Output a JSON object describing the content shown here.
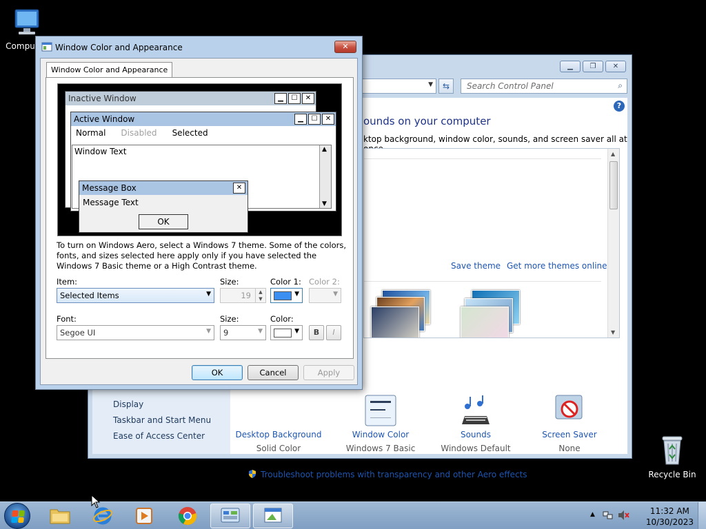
{
  "desktop": {
    "computer_label": "Computer",
    "recycle_bin_label": "Recycle Bin"
  },
  "personalization": {
    "search_placeholder": "Search Control Panel",
    "heading": "ounds on your computer",
    "description": "ktop background, window color, sounds, and screen saver all at once.",
    "save_theme": "Save theme",
    "get_more_themes": "Get more themes online",
    "left_links": [
      "Display",
      "Taskbar and Start Menu",
      "Ease of Access Center"
    ],
    "bottom_items": [
      {
        "label": "Desktop Background",
        "sub": "Solid Color",
        "icon": "desktop-background-icon"
      },
      {
        "label": "Window Color",
        "sub": "Windows 7 Basic",
        "icon": "window-color-icon"
      },
      {
        "label": "Sounds",
        "sub": "Windows Default",
        "icon": "sounds-icon"
      },
      {
        "label": "Screen Saver",
        "sub": "None",
        "icon": "screen-saver-icon"
      }
    ],
    "troubleshoot": "Troubleshoot problems with transparency and other Aero effects"
  },
  "dialog": {
    "title": "Window Color and Appearance",
    "tab_label": "Window Color and Appearance",
    "preview": {
      "inactive_title": "Inactive Window",
      "active_title": "Active Window",
      "menu_normal": "Normal",
      "menu_disabled": "Disabled",
      "menu_selected": "Selected",
      "window_text": "Window Text",
      "msgbox_title": "Message Box",
      "msgbox_text": "Message Text",
      "msgbox_ok": "OK"
    },
    "aero_note": "To turn on Windows Aero, select a Windows 7 theme.  Some of the colors, fonts, and sizes selected here apply only if you have selected the Windows 7 Basic theme or a High Contrast theme.",
    "item_label": "Item:",
    "item_value": "Selected Items",
    "size_label": "Size:",
    "size_value": "19",
    "color1_label": "Color 1:",
    "color2_label": "Color 2:",
    "color1_hex": "#3a8ff0",
    "font_label": "Font:",
    "font_value": "Segoe UI",
    "font_size_label": "Size:",
    "font_size_value": "9",
    "font_color_label": "Color:",
    "bold_label": "B",
    "italic_label": "I",
    "ok_label": "OK",
    "cancel_label": "Cancel",
    "apply_label": "Apply"
  },
  "taskbar": {
    "time": "11:32 AM",
    "date": "10/30/2023"
  }
}
